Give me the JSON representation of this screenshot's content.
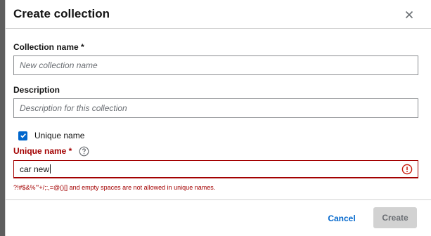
{
  "dialog": {
    "title": "Create collection",
    "close_icon": "close-icon"
  },
  "form": {
    "collection_name": {
      "label": "Collection name *",
      "value": "",
      "placeholder": "New collection name"
    },
    "description": {
      "label": "Description",
      "value": "",
      "placeholder": "Description for this collection"
    },
    "unique_name_checkbox": {
      "label": "Unique name",
      "checked": true
    },
    "unique_name": {
      "label": "Unique name *",
      "value": "car new",
      "help_icon": "question-circle-icon",
      "error_icon": "exclamation-circle-icon",
      "error_text": "?!#$&%'\"+/;:,=@()[] and empty spaces are not allowed in unique names."
    }
  },
  "footer": {
    "cancel_label": "Cancel",
    "create_label": "Create"
  },
  "colors": {
    "primary": "#0066cc",
    "danger": "#a30000",
    "disabled_bg": "#d2d2d2",
    "overlay": "#5e5e5e"
  }
}
